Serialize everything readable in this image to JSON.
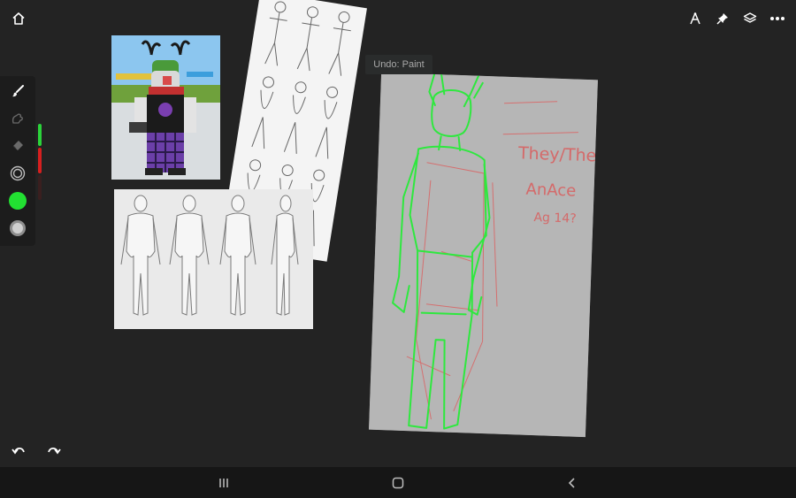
{
  "toolbar": {
    "home_icon": "home-icon",
    "right_icons": [
      "ruler-compass-icon",
      "pin-icon",
      "layers-icon",
      "more-icon"
    ]
  },
  "tools": {
    "items": [
      "brush-icon",
      "smudge-icon",
      "eraser-icon",
      "brush-size-icon",
      "color-swatch-icon",
      "opacity-icon"
    ],
    "current_color": "#22e032",
    "size_slider_color": "#2bd33a",
    "opacity_slider_color": "#d61f1f"
  },
  "toast": {
    "undo_label": "Undo: Paint"
  },
  "sketch": {
    "pronoun_text": "They/Them",
    "name_text": "AnAce",
    "age_text": "Ag 14?"
  },
  "actions": {
    "undo_icon": "undo-icon",
    "redo_icon": "redo-icon"
  },
  "navigation": {
    "items": [
      "recent-apps-icon",
      "home-nav-icon",
      "back-icon"
    ]
  }
}
